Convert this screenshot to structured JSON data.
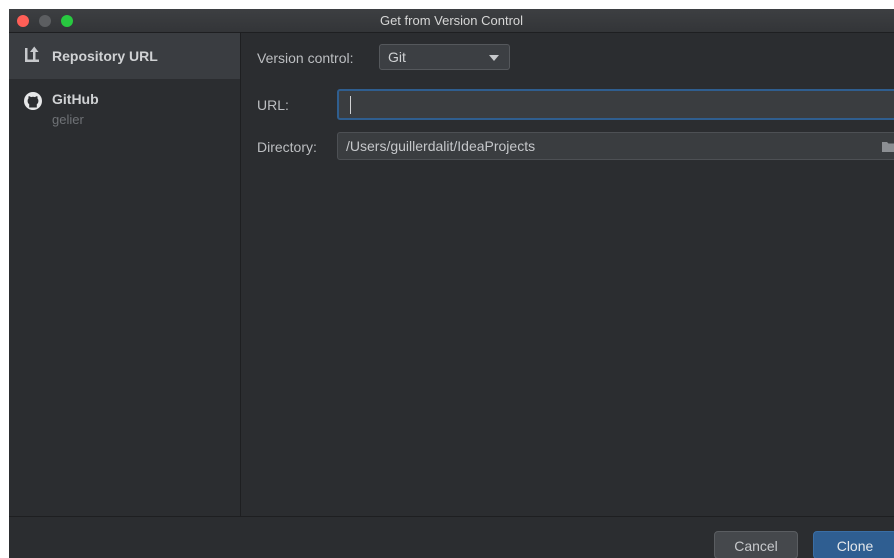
{
  "window": {
    "title": "Get from Version Control"
  },
  "sidebar": {
    "items": [
      {
        "label": "Repository URL",
        "icon": "repository-url-icon",
        "selected": true
      },
      {
        "label": "GitHub",
        "sublabel": "gelier",
        "icon": "github-icon",
        "selected": false
      }
    ]
  },
  "form": {
    "version_control_label": "Version control:",
    "version_control_value": "Git",
    "url_label": "URL:",
    "url_value": "",
    "directory_label": "Directory:",
    "directory_value": "/Users/guillerdalit/IdeaProjects"
  },
  "footer": {
    "cancel_label": "Cancel",
    "clone_label": "Clone"
  },
  "colors": {
    "background": "#2b2d30",
    "accent": "#2f5e91",
    "focus_border": "#2f5e8f"
  }
}
